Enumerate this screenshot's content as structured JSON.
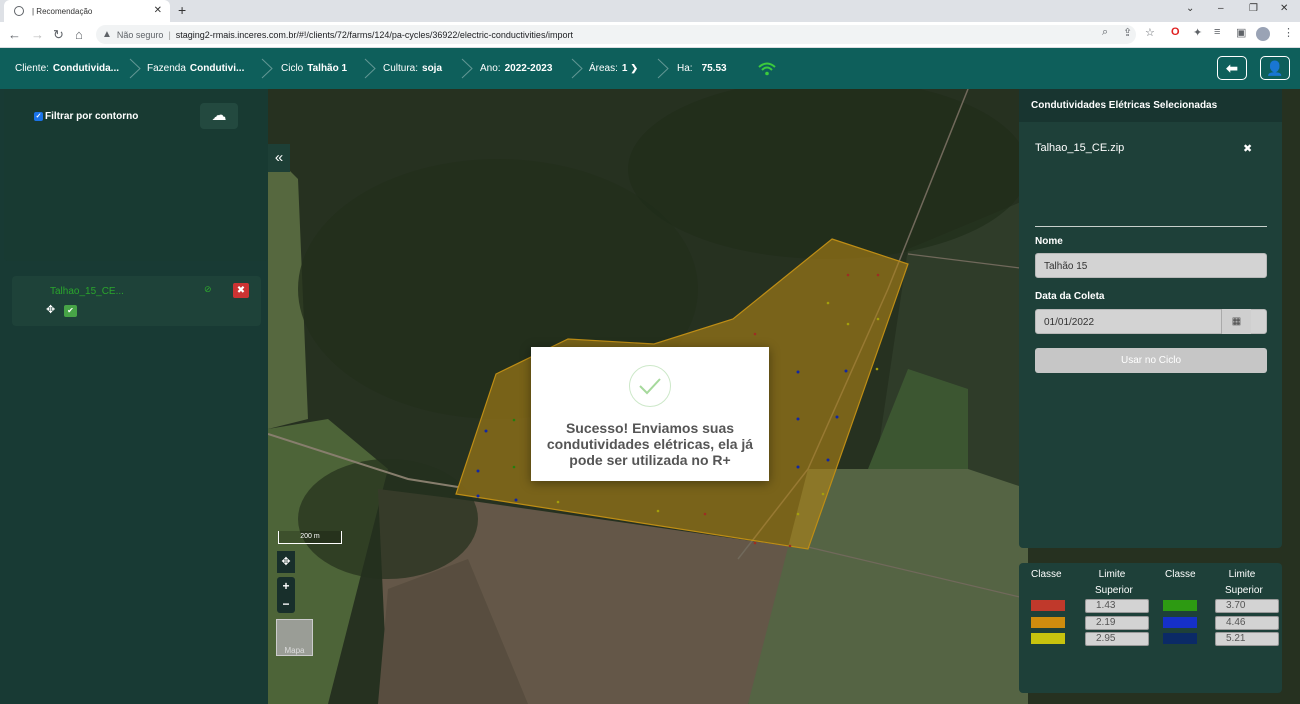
{
  "browser": {
    "tab_title": "| Recomendação",
    "tab_close": "✕",
    "new_tab": "+",
    "security": "Não seguro",
    "url": "staging2-rmais.inceres.com.br/#!/clients/72/farms/124/pa-cycles/36922/electric-conductivities/import",
    "win_chevron": "⌄",
    "win_min": "–",
    "win_max": "❐",
    "win_close": "✕"
  },
  "header": {
    "cliente_label": "Cliente:",
    "cliente_value": "Condutivida...",
    "fazenda_label": "Fazenda",
    "fazenda_value": "Condutivi...",
    "ciclo_label": "Ciclo",
    "ciclo_value": "Talhão 1",
    "cultura_label": "Cultura:",
    "cultura_value": "soja",
    "ano_label": "Ano:",
    "ano_value": "2022-2023",
    "areas_label": "Áreas:",
    "areas_value": "1",
    "ha_label": "Ha:",
    "ha_value": "75.53",
    "back_icon": "back-arrow-icon",
    "user_icon": "user-icon"
  },
  "left_panel": {
    "filter_label": "Filtrar por contorno",
    "filter_checked": true,
    "upload_icon": "cloud-upload-icon",
    "collapse_glyph": "«",
    "files": [
      {
        "name": "Talhao_15_CE...",
        "ok_glyph": "⊘",
        "delete_glyph": "✖",
        "move_glyph": "✥",
        "check_glyph": "✔"
      }
    ]
  },
  "right_panel": {
    "title": "Condutividades Elétricas Selecionadas",
    "file_name": "Talhao_15_CE.zip",
    "remove_glyph": "✖",
    "nome_label": "Nome",
    "nome_value": "Talhão 15",
    "data_label": "Data da Coleta",
    "data_value": "01/01/2022",
    "calendar_glyph": "▦",
    "use_button": "Usar no Ciclo"
  },
  "legend": {
    "class_header": "Classe",
    "limit_header_1": "Limite",
    "limit_header_2": "Superior",
    "classes": [
      {
        "color": "#c0392b",
        "limit": "1.43"
      },
      {
        "color": "#cf8c0e",
        "limit": "2.19"
      },
      {
        "color": "#c8c30e",
        "limit": "2.95"
      },
      {
        "color": "#2d9a12",
        "limit": "3.70"
      },
      {
        "color": "#1630c8",
        "limit": "4.46"
      },
      {
        "color": "#0b2a66",
        "limit": "5.21"
      }
    ]
  },
  "map": {
    "scale": "200 m",
    "move_glyph": "✥",
    "zoom_in": "+",
    "zoom_out": "−",
    "layer_label": "Mapa",
    "field_color": "#d9a21a"
  },
  "modal": {
    "message": "Sucesso! Enviamos suas condutividades elétricas, ela já pode ser utilizada no R+",
    "icon": "checkmark-icon"
  }
}
